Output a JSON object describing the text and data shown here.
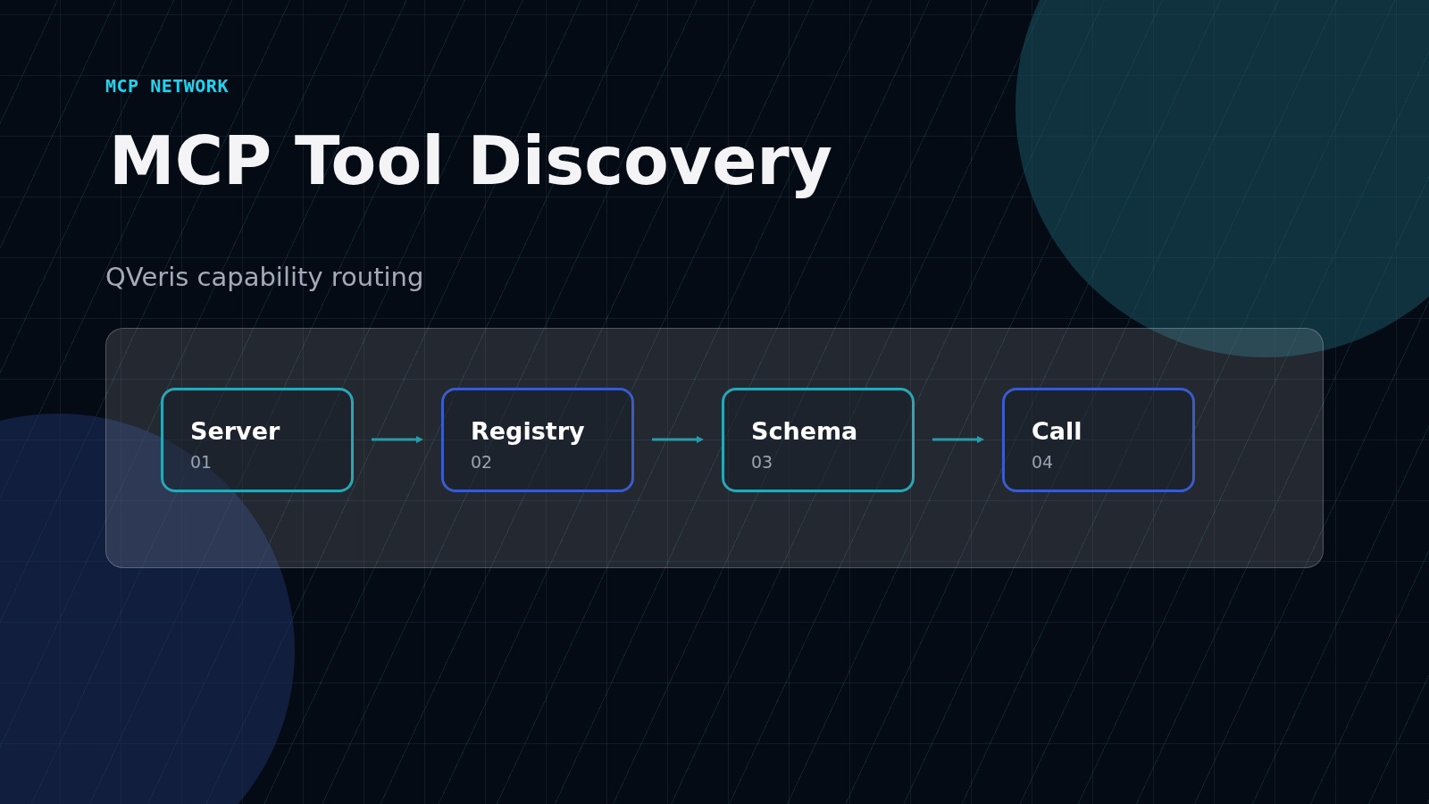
{
  "kicker": "MCP NETWORK",
  "title": "MCP Tool Discovery",
  "subtitle": "QVeris capability routing",
  "flow": {
    "steps": [
      {
        "label": "Server",
        "number": "01",
        "color": "#2aa6b4"
      },
      {
        "label": "Registry",
        "number": "02",
        "color": "#3b5cc8"
      },
      {
        "label": "Schema",
        "number": "03",
        "color": "#2aa6b4"
      },
      {
        "label": "Call",
        "number": "04",
        "color": "#3b5cc8"
      }
    ]
  }
}
